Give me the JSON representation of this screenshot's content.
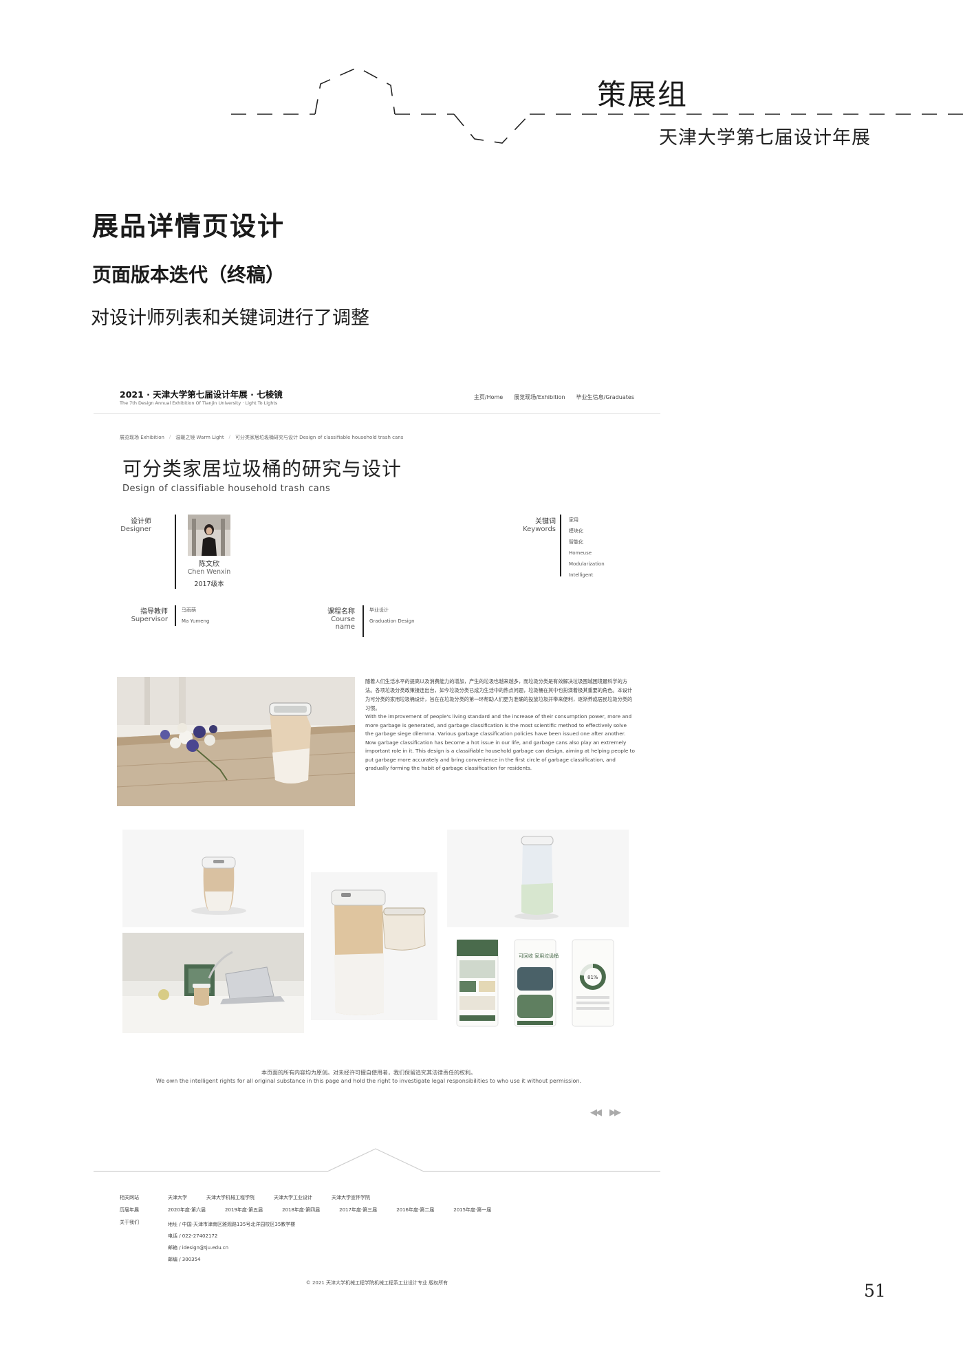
{
  "header": {
    "group_title": "策展组",
    "group_subtitle": "天津大学第七届设计年展"
  },
  "section": {
    "title": "展品详情页设计",
    "subtitle": "页面版本迭代（终稿）",
    "description": "对设计师列表和关键词进行了调整"
  },
  "site": {
    "logo_cn": "2021 · 天津大学第七届设计年展 · 七棱镜",
    "logo_en": "The 7th Design Annual Exhibition Of Tianjin University · Light To Lights",
    "nav": [
      "主页/Home",
      "展览现场/Exhibition",
      "毕业生信息/Graduates"
    ],
    "breadcrumb": [
      "展览现场 Exhibition",
      "温暖之镜 Warm Light",
      "可分类家居垃圾桶研究与设计 Design of classifiable household trash cans"
    ],
    "title_cn": "可分类家居垃圾桶的研究与设计",
    "title_en": "Design of classifiable household trash cans",
    "designer_label_cn": "设计师",
    "designer_label_en": "Designer",
    "designer_name_cn": "陈文欣",
    "designer_name_en": "Chen Wenxin",
    "designer_year": "2017级本",
    "keywords_label_cn": "关键词",
    "keywords_label_en": "Keywords",
    "keywords": [
      "家用",
      "模块化",
      "智能化",
      "Homeuse",
      "Modularization",
      "Intelligent"
    ],
    "supervisor_label_cn": "指导教师",
    "supervisor_label_en": "Supervisor",
    "supervisor_cn": "马雨萌",
    "supervisor_en": "Ma Yumeng",
    "course_label_cn": "课程名称",
    "course_label_en_1": "Course",
    "course_label_en_2": "name",
    "course_cn": "毕业设计",
    "course_en": "Graduation Design",
    "body_cn": "随着人们生活水平的提高以及消费能力的增加，产生的垃圾也越来越多，而垃圾分类是有效解决垃圾围城困境最科学的方法。各项垃圾分类政策接连出台，如今垃圾分类已成为生活中的热点问题，垃圾桶在其中也扮演着极其重要的角色。本设计为可分类的家用垃圾桶设计，旨在在垃圾分类的第一环帮助人们更为准确的投放垃圾并带来便利，逐渐养成居民垃圾分类的习惯。",
    "body_en": "With the improvement of people's living standard and the increase of their consumption power, more and more garbage is generated, and garbage classification is the most scientific method to effectively solve the garbage siege dilemma. Various garbage classification policies have been issued one after another. Now garbage classification has become a hot issue in our life, and garbage cans also play an extremely important role in it. This design is a classifiable household garbage can design, aiming at helping people to put garbage more accurately and bring convenience in the first circle of garbage classification, and gradually forming the habit of garbage classification for residents.",
    "app_screens": {
      "screen2_title": "可回收 家用垃圾桶",
      "screen3_percent": "81%"
    },
    "copyright_cn": "本页面的所有内容均为原创。对未经许可擅自使用者，我们保留追究其法律责任的权利。",
    "copyright_en": "We own the intelligent rights for all original substance in this page and hold the right to investigate legal responsibilities to who use it without permission.",
    "pager_prev": "◀◀",
    "pager_next": "▶▶",
    "footer": {
      "related_label": "相关网站",
      "related": [
        "天津大学",
        "天津大学机械工程学院",
        "天津大学工业设计",
        "天津大学宣怀学院"
      ],
      "history_label": "历届年展",
      "history": [
        "2020年度·第六届",
        "2019年度·第五届",
        "2018年度·第四届",
        "2017年度·第三届",
        "2016年度·第二届",
        "2015年度·第一届"
      ],
      "about_label": "关于我们",
      "about": [
        "地址 / 中国·天津市津南区雅观路135号北洋园校区35教学楼",
        "电话 / 022-27402172",
        "邮箱 / idesign@tju.edu.cn",
        "邮编 / 300354"
      ],
      "copyright": "© 2021 天津大学机械工程学院机械工程系工业设计专业 版权所有"
    }
  },
  "page_number": "51",
  "colors": {
    "text": "#222222",
    "accent_green": "#4a6b4c",
    "product_tan": "#c9a47a"
  }
}
